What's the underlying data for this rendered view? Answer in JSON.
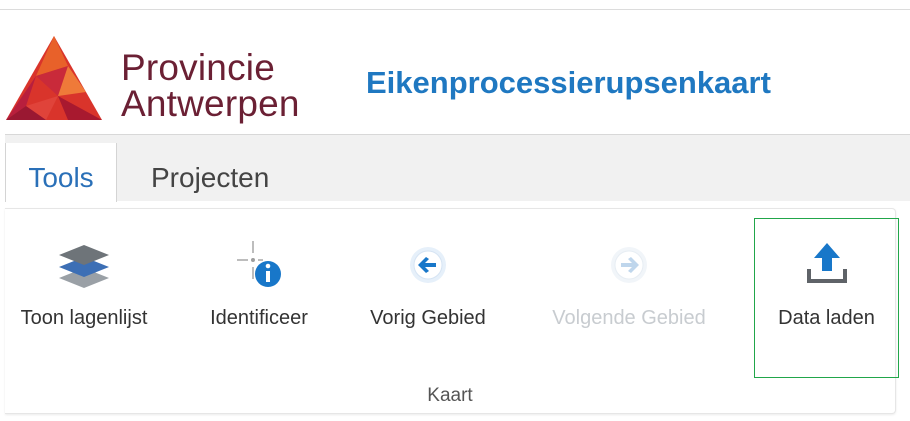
{
  "header": {
    "logo_line1": "Provincie",
    "logo_line2": "Antwerpen",
    "app_title": "Eikenprocessierupsenkaart"
  },
  "tabs": [
    {
      "label": "Tools",
      "active": true
    },
    {
      "label": "Projecten",
      "active": false
    }
  ],
  "ribbon": {
    "group_label": "Kaart",
    "tools": [
      {
        "label": "Toon lagenlijst",
        "icon": "layers-icon",
        "enabled": true
      },
      {
        "label": "Identificeer",
        "icon": "identify-icon",
        "enabled": true
      },
      {
        "label": "Vorig Gebied",
        "icon": "back-arrow-icon",
        "enabled": true
      },
      {
        "label": "Volgende Gebied",
        "icon": "forward-arrow-icon",
        "enabled": false
      },
      {
        "label": "Data laden",
        "icon": "upload-icon",
        "enabled": true,
        "highlighted": true
      }
    ]
  },
  "colors": {
    "brand": "#6b2034",
    "title": "#1f78c1",
    "accent_blue": "#1877c9",
    "highlight_border": "#21a64a"
  }
}
